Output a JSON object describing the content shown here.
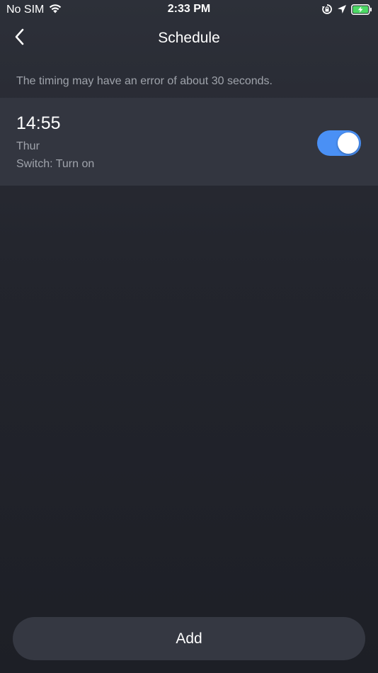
{
  "status_bar": {
    "carrier": "No SIM",
    "time": "2:33 PM",
    "icons": [
      "wifi-icon",
      "rotation-lock-icon",
      "location-arrow-icon",
      "battery-charging-icon"
    ]
  },
  "nav": {
    "title": "Schedule",
    "back_icon": "chevron-left-icon"
  },
  "notice": "The timing may have an error of about 30 seconds.",
  "schedules": [
    {
      "time": "14:55",
      "days": "Thur",
      "action": "Switch: Turn on",
      "enabled": true
    }
  ],
  "add_label": "Add",
  "colors": {
    "toggle_on": "#4a90f5",
    "battery_green": "#4cd964",
    "row_background": "#333640"
  }
}
